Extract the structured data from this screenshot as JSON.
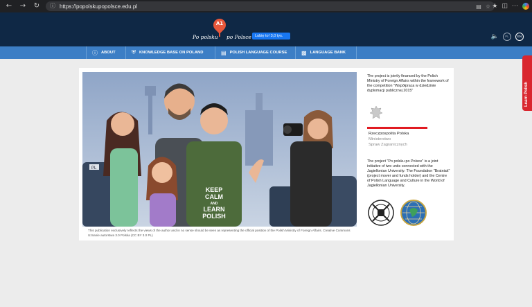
{
  "browser": {
    "url": "https://popolskupopolsce.edu.pl",
    "zoom_icon": "reader-icon"
  },
  "header": {
    "logo_badge": "A1",
    "logo_left": "Po polsku",
    "logo_right": "po Polsce",
    "like_label": "Lubię to! 3,0 tys.",
    "lang_pl": "PL",
    "lang_en": "EN"
  },
  "nav": {
    "items": [
      {
        "label": "ABOUT",
        "icon": "info-icon"
      },
      {
        "label": "KNOWLEDGE BASE ON POLAND",
        "icon": "shield-icon"
      },
      {
        "label": "POLISH LANGUAGE COURSE",
        "icon": "book-icon"
      },
      {
        "label": "LANGUAGE BANK",
        "icon": "card-icon"
      }
    ]
  },
  "learn_tab": "Learn Polish",
  "hero": {
    "shirt_text": [
      "KEEP",
      "CALM",
      "AND",
      "LEARN",
      "POLISH"
    ],
    "suitcase_tag": "PL"
  },
  "caption": "This publication exclusively reflects the views of the author and in no sense should be seen as representing the official position of the Polish Ministry of Foreign Affairs. Creative Commons Uznanie autorstwa 3.0 Polska (CC BY 3.0 PL)",
  "sidebar": {
    "financed": "The project is jointly financed by the Polish Ministry of Foreign Affairs within the framework of the competition \"Współpraca w dziedzinie dyplomacji publicznej 2015\"",
    "ministry_line1": "Rzeczpospolita Polska",
    "ministry_line2": "Ministerstwo",
    "ministry_line3": "Spraw Zagranicznych",
    "initiative": "The project \"Po polsku po Polsce\" is a joint initiative of two units connected with the Jagiellonian University: The Foundation \"Bratniak\" (project mover and funds holder) and the Centre of Polish Language and Culture in the World of Jagiellonian University."
  },
  "colors": {
    "header_bg": "#0f2845",
    "nav_bg": "#3c7ec5",
    "accent_red": "#e11b22",
    "pin": "#e8573b"
  }
}
